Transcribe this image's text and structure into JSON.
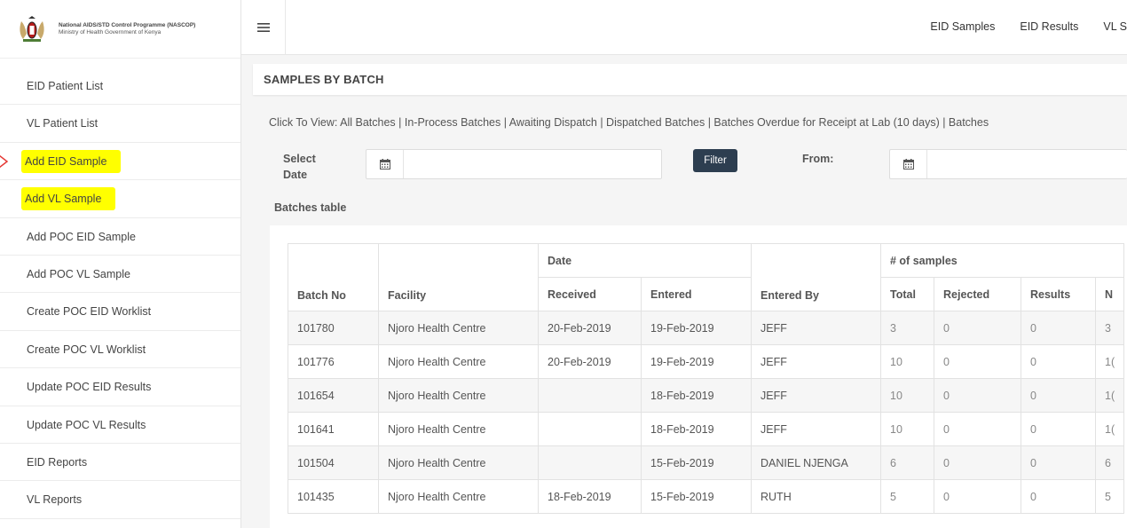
{
  "brand": {
    "org_line1": "National AIDS/STD Control Programme (NASCOP)",
    "org_line2": "Ministry of Health Government of Kenya"
  },
  "sidebar": {
    "items": [
      {
        "label": "EID Patient List",
        "highlighted": false
      },
      {
        "label": "VL Patient List",
        "highlighted": false
      },
      {
        "label": "Add EID Sample",
        "highlighted": true
      },
      {
        "label": "Add VL Sample",
        "highlighted": true
      },
      {
        "label": "Add POC EID Sample",
        "highlighted": false
      },
      {
        "label": "Add POC VL Sample",
        "highlighted": false
      },
      {
        "label": "Create POC EID Worklist",
        "highlighted": false
      },
      {
        "label": "Create POC VL Worklist",
        "highlighted": false
      },
      {
        "label": "Update POC EID Results",
        "highlighted": false
      },
      {
        "label": "Update POC VL Results",
        "highlighted": false
      },
      {
        "label": "EID Reports",
        "highlighted": false
      },
      {
        "label": "VL Reports",
        "highlighted": false
      }
    ]
  },
  "topnav": {
    "menu_icon": "hamburger-icon",
    "items": [
      "EID Samples",
      "EID Results",
      "VL S"
    ]
  },
  "page": {
    "title": "SAMPLES BY BATCH",
    "view_links": "Click To View: All Batches | In-Process Batches | Awaiting Dispatch | Dispatched Batches | Batches Overdue for Receipt at Lab (10 days) | Batches",
    "select_date_label": "Select Date",
    "from_label": "From:",
    "filter_button": "Filter",
    "calendar_icon": "calendar-icon",
    "date_value": "",
    "from_value": "",
    "table_title": "Batches table"
  },
  "table": {
    "group_headers": {
      "date": "Date",
      "samples": "# of samples"
    },
    "headers": [
      "Batch No",
      "Facility",
      "Received",
      "Entered",
      "Entered By",
      "Total",
      "Rejected",
      "Results",
      "N"
    ],
    "rows": [
      [
        "101780",
        "Njoro Health Centre",
        "20-Feb-2019",
        "19-Feb-2019",
        "JEFF",
        "3",
        "0",
        "0",
        "3"
      ],
      [
        "101776",
        "Njoro Health Centre",
        "20-Feb-2019",
        "19-Feb-2019",
        "JEFF",
        "10",
        "0",
        "0",
        "1("
      ],
      [
        "101654",
        "Njoro Health Centre",
        "",
        "18-Feb-2019",
        "JEFF",
        "10",
        "0",
        "0",
        "1("
      ],
      [
        "101641",
        "Njoro Health Centre",
        "",
        "18-Feb-2019",
        "JEFF",
        "10",
        "0",
        "0",
        "1("
      ],
      [
        "101504",
        "Njoro Health Centre",
        "",
        "15-Feb-2019",
        "DANIEL NJENGA",
        "6",
        "0",
        "0",
        "6"
      ],
      [
        "101435",
        "Njoro Health Centre",
        "18-Feb-2019",
        "15-Feb-2019",
        "RUTH",
        "5",
        "0",
        "0",
        "5"
      ]
    ]
  },
  "colors": {
    "highlight": "#ffff00",
    "button": "#2d3e50",
    "arrow": "#e53935"
  }
}
